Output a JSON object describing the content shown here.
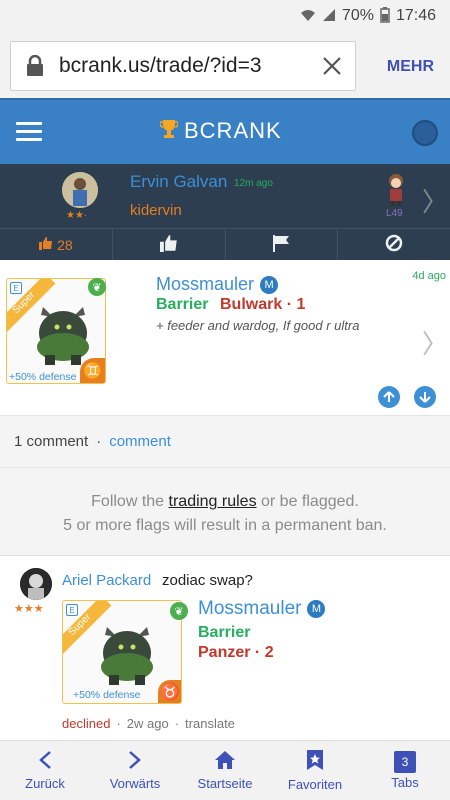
{
  "status_bar": {
    "battery": "70%",
    "time": "17:46"
  },
  "browser": {
    "url": "bcrank.us/trade/?id=3",
    "menu_label": "MEHR"
  },
  "app": {
    "logo_text": "BCRANK"
  },
  "trader": {
    "name": "Ervin Galvan",
    "time_ago": "12m ago",
    "handle": "kidervin",
    "stars": "★★·",
    "level": "L49",
    "like_count": "28"
  },
  "offer": {
    "rarity": "Super",
    "defense_bonus": "+50% defense",
    "monster_name": "Mossmauler",
    "rank_badge": "M",
    "role": "Barrier",
    "element_label": "Bulwark · 1",
    "note": "+ feeder and wardog, If good r ultra",
    "age": "4d ago"
  },
  "comments_bar": {
    "count_text": "1 comment",
    "separator": "·",
    "link_text": "comment"
  },
  "rules": {
    "pre": "Follow the ",
    "link": "trading rules",
    "post": " or be flagged.",
    "line2": "5 or more flags will result in a permanent ban."
  },
  "comment": {
    "author": "Ariel Packard",
    "stars": "★★★",
    "text": "zodiac swap?",
    "rarity": "Super",
    "defense_bonus": "+50% defense",
    "monster_name": "Mossmauler",
    "rank_badge": "M",
    "role": "Barrier",
    "element_label": "Panzer · 2",
    "status": "declined",
    "sep1": "·",
    "age": "2w ago",
    "sep2": "·",
    "translate": "translate"
  },
  "bottom_nav": {
    "back": "Zurück",
    "forward": "Vorwärts",
    "home": "Startseite",
    "favorites": "Favoriten",
    "tabs": "Tabs",
    "tabs_count": "3"
  },
  "colors": {
    "header_blue": "#3a80c4",
    "dark_row": "#2c3e50",
    "accent_orange": "#e67e22",
    "link_blue": "#3d8fd6",
    "green": "#27ae60",
    "red": "#c0392b"
  }
}
